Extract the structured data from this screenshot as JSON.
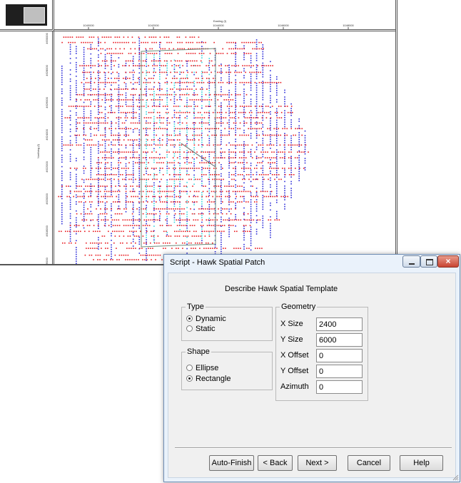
{
  "map": {
    "x_axis_title": "Easting (f)",
    "x_ticks": [
      "1040000",
      "1042000",
      "1044000",
      "1046000",
      "1048000"
    ],
    "y_axis_title": "Northing (f)",
    "y_ticks": [
      "4630000",
      "4628000",
      "4626000",
      "4624000",
      "4622000",
      "4620000",
      "4618000",
      "4616000"
    ],
    "colors": {
      "trace_red": "#e8181e",
      "trace_blue": "#2b2bd9",
      "patch_cyan": "#33d6e0"
    }
  },
  "dialog": {
    "title": "Script - Hawk Spatial Patch",
    "window_buttons": {
      "close_glyph": "×"
    },
    "heading": "Describe Hawk Spatial Template",
    "type_group": {
      "label": "Type",
      "options": [
        "Dynamic",
        "Static"
      ],
      "selected": "Dynamic"
    },
    "shape_group": {
      "label": "Shape",
      "options": [
        "Ellipse",
        "Rectangle"
      ],
      "selected": "Rectangle"
    },
    "geometry_group": {
      "label": "Geometry",
      "fields": [
        {
          "label": "X Size",
          "value": "2400"
        },
        {
          "label": "Y Size",
          "value": "6000"
        },
        {
          "label": "X Offset",
          "value": "0"
        },
        {
          "label": "Y Offset",
          "value": "0"
        },
        {
          "label": "Azimuth",
          "value": "0"
        }
      ]
    },
    "buttons": {
      "auto_finish": "Auto-Finish",
      "back": "< Back",
      "next": "Next >",
      "cancel": "Cancel",
      "help": "Help"
    },
    "colors": {
      "titlebar": "#eaf2fb",
      "client": "#f0f0f0",
      "close_button": "#c84431"
    }
  }
}
